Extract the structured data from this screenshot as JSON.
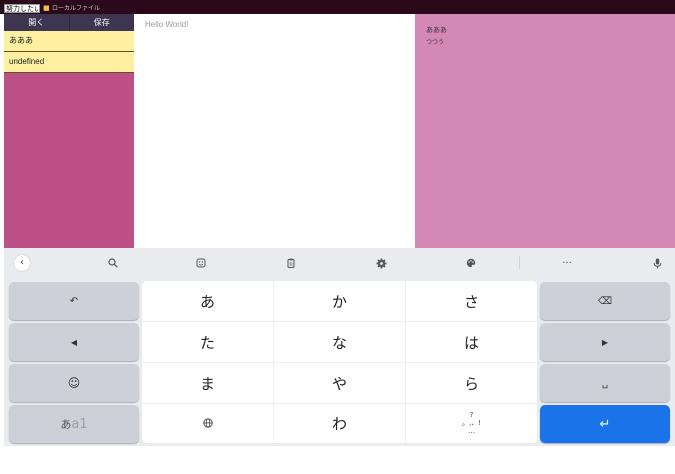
{
  "topbar": {
    "search_value": "努力したい",
    "status_text": "ローカルファイル"
  },
  "sidebar": {
    "open_label": "開く",
    "save_label": "保存",
    "files": [
      "あああ",
      "undefined"
    ]
  },
  "editor": {
    "placeholder": "Hello World!"
  },
  "preview": {
    "lines": [
      "あああ",
      "つつう"
    ]
  },
  "keyboard": {
    "toolbar_icons": [
      "chevron-left-icon",
      "search-icon",
      "sticker-icon",
      "clipboard-icon",
      "settings-icon",
      "palette-icon",
      "more-icon",
      "mic-icon"
    ],
    "left_keys": {
      "undo": "↶",
      "cursor_left": "◀",
      "emoji": "☺",
      "mode": "あ",
      "mode_alt": "a1"
    },
    "grid": [
      [
        "あ",
        "か",
        "さ"
      ],
      [
        "た",
        "な",
        "は"
      ],
      [
        "ま",
        "や",
        "ら"
      ]
    ],
    "bottom_row": {
      "globe": "🌐",
      "wa": "わ",
      "punct_top": "?",
      "punct_mid": "。,、!",
      "punct_bot": "…"
    },
    "right_keys": {
      "backspace": "⌫",
      "cursor_right": "▶",
      "space": "␣",
      "enter": "↵"
    },
    "colors": {
      "accent": "#1a73e8",
      "sidebar": "#be5088",
      "preview": "#d488b6"
    }
  }
}
